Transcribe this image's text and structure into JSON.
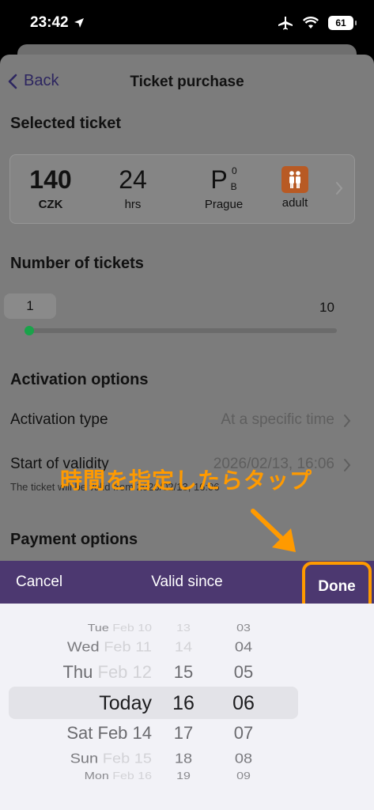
{
  "status_bar": {
    "time": "23:42",
    "battery": "61"
  },
  "nav": {
    "back_label": "Back",
    "title": "Ticket purchase"
  },
  "selected_ticket": {
    "section_title": "Selected ticket",
    "price": "140",
    "currency": "CZK",
    "duration": "24",
    "duration_unit": "hrs",
    "zone_letter": "P",
    "zone_sup": "0",
    "zone_sub": "B",
    "zone_city": "Prague",
    "passenger_type": "adult"
  },
  "number_of_tickets": {
    "section_title": "Number of tickets",
    "value": "1",
    "max": "10",
    "level": 0.0
  },
  "activation_options": {
    "section_title": "Activation options",
    "type_label": "Activation type",
    "type_value": "At a specific time",
    "start_label": "Start of validity",
    "start_value": "2026/02/13, 16:06",
    "note": "The ticket will be valid from 2026/02/13, 16:06"
  },
  "payment_options": {
    "section_title": "Payment options"
  },
  "annotation": {
    "text": "時間を指定したらタップ",
    "color": "#ff9a00"
  },
  "picker_bar": {
    "cancel_label": "Cancel",
    "title": "Valid since",
    "done_label": "Done"
  },
  "picker": {
    "rows": [
      {
        "dow": "Tue",
        "date": "Feb 10",
        "hour": "13",
        "minute": "03"
      },
      {
        "dow": "Wed",
        "date": "Feb 11",
        "hour": "14",
        "minute": "04"
      },
      {
        "dow": "Thu",
        "date": "Feb 12",
        "hour": "15",
        "minute": "05"
      },
      {
        "dow": "",
        "date": "Today",
        "hour": "16",
        "minute": "06"
      },
      {
        "dow": "Sat",
        "date": "Feb 14",
        "hour": "17",
        "minute": "07"
      },
      {
        "dow": "Sun",
        "date": "Feb 15",
        "hour": "18",
        "minute": "08"
      },
      {
        "dow": "Mon",
        "date": "Feb 16",
        "hour": "19",
        "minute": "09"
      }
    ]
  },
  "colors": {
    "accent": "#4c3870",
    "highlight": "#ff9a00",
    "slider": "#19a34a",
    "adult_badge": "#b85a24"
  }
}
